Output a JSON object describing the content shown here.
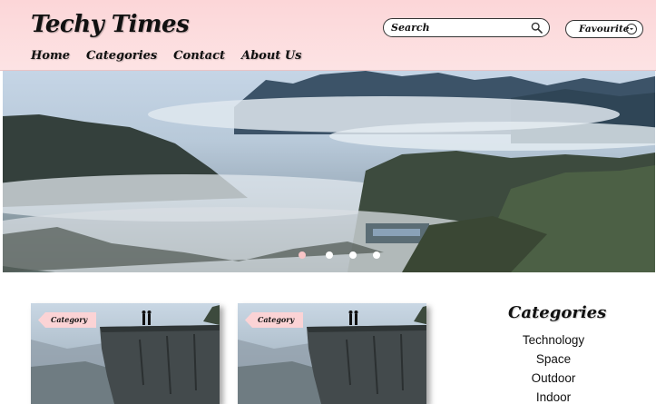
{
  "header": {
    "brand": "Techy Times",
    "nav": [
      "Home",
      "Categories",
      "Contact",
      "About Us"
    ],
    "search_placeholder": "Search",
    "favourite_label": "Favourite",
    "background": "#fcd6d8"
  },
  "hero": {
    "slides_count": 4,
    "active_slide": 1,
    "active_dot_color": "#f7c4c6"
  },
  "cards": [
    {
      "tag": "Category"
    },
    {
      "tag": "Category"
    }
  ],
  "sidebar": {
    "title": "Categories",
    "items": [
      "Technology",
      "Space",
      "Outdoor",
      "Indoor"
    ]
  },
  "icons": {
    "search": "search-icon",
    "favourite": "chevron-down-circle-icon"
  }
}
